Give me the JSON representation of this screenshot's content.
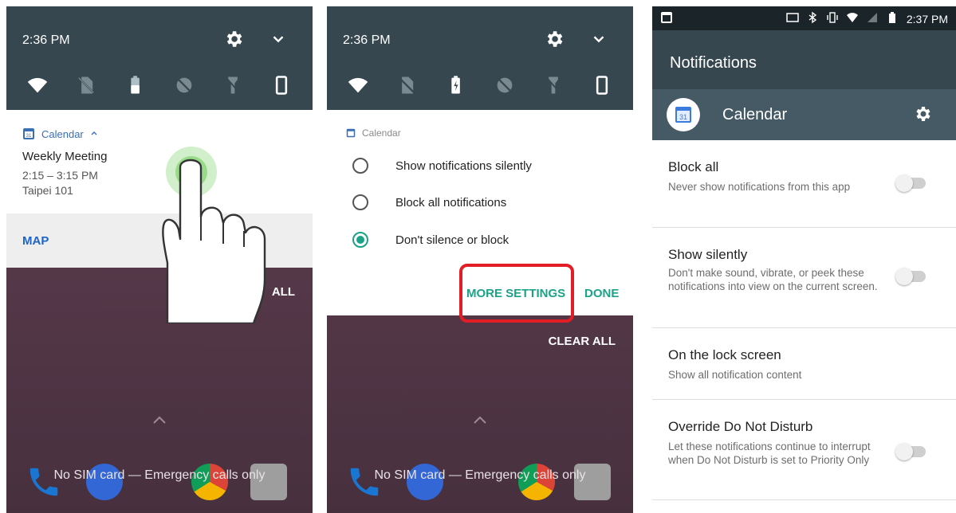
{
  "panel1": {
    "time": "2:36 PM",
    "notification": {
      "app": "Calendar",
      "title": "Weekly Meeting",
      "time_range": "2:15 – 3:15 PM",
      "location": "Taipei 101",
      "action": "MAP"
    },
    "clear_all": "ALL",
    "sim_status": "No SIM card — Emergency calls only"
  },
  "panel2": {
    "time": "2:36 PM",
    "app": "Calendar",
    "options": [
      {
        "label": "Show notifications silently",
        "selected": false
      },
      {
        "label": "Block all notifications",
        "selected": false
      },
      {
        "label": "Don't silence or block",
        "selected": true
      }
    ],
    "more_settings": "MORE SETTINGS",
    "done": "DONE",
    "clear_all": "CLEAR ALL",
    "sim_status": "No SIM card — Emergency calls only"
  },
  "panel3": {
    "time": "2:37 PM",
    "page_title": "Notifications",
    "app_name": "Calendar",
    "items": [
      {
        "title": "Block all",
        "desc": "Never show notifications from this app",
        "toggle": false
      },
      {
        "title": "Show silently",
        "desc": "Don't make sound, vibrate, or peek these notifications into view on the current screen.",
        "toggle": false
      },
      {
        "title": "On the lock screen",
        "desc": "Show all notification content"
      },
      {
        "title": "Override Do Not Disturb",
        "desc": "Let these notifications continue to interrupt when Do Not Disturb is set to Priority Only",
        "toggle": false
      }
    ]
  },
  "colors": {
    "header": "#37474f",
    "accent_teal": "#1aa387",
    "link_blue": "#1e64c8",
    "highlight_red": "#e21d25"
  }
}
